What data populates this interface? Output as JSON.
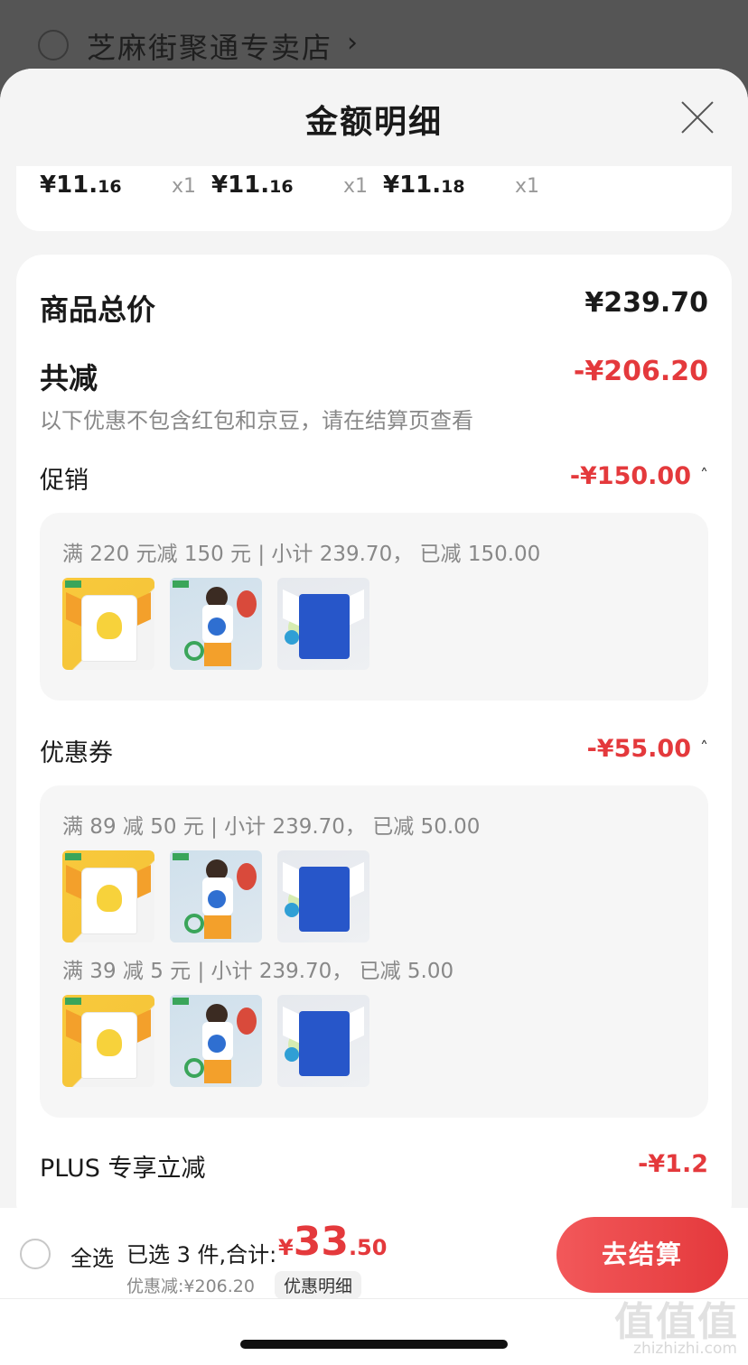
{
  "store": {
    "name": "芝麻街聚通专卖店",
    "arrow": "›"
  },
  "sheet": {
    "title": "金额明细"
  },
  "top_prices": [
    {
      "main": "¥11.",
      "dec": "16",
      "qty": "x1"
    },
    {
      "main": "¥11.",
      "dec": "16",
      "qty": "x1"
    },
    {
      "main": "¥11.",
      "dec": "18",
      "qty": "x1"
    }
  ],
  "summary": {
    "total_label": "商品总价",
    "total_value": "¥239.70",
    "reduce_label": "共减",
    "reduce_value": "-¥206.20",
    "hint": "以下优惠不包含红包和京豆，请在结算页查看"
  },
  "promotion": {
    "label": "促销",
    "value": "-¥150.00",
    "rule": "满 220 元减 150 元 | 小计 239.70， 已减 150.00"
  },
  "coupon": {
    "label": "优惠券",
    "value": "-¥55.00",
    "rules": [
      "满 89 减 50 元 | 小计 239.70， 已减 50.00",
      "满 39 减 5 元 | 小计 239.70， 已减 5.00"
    ]
  },
  "plus": {
    "label": "PLUS 专享立减",
    "value": "-¥1.2"
  },
  "caret": "˄",
  "bottom": {
    "select_all": "全选",
    "selected_text": "已选 3 件,合计:",
    "total_symbol": "¥",
    "total_int": "33",
    "total_dec": ".50",
    "discount_text": "优惠减:¥206.20",
    "detail_link": "优惠明细",
    "checkout": "去结算"
  },
  "watermark": {
    "main": "值值值",
    "sub": "zhizhizhi.com"
  },
  "colors": {
    "accent_red": "#e4393c",
    "sheet_bg": "#f4f4f4",
    "card_bg": "#ffffff"
  }
}
